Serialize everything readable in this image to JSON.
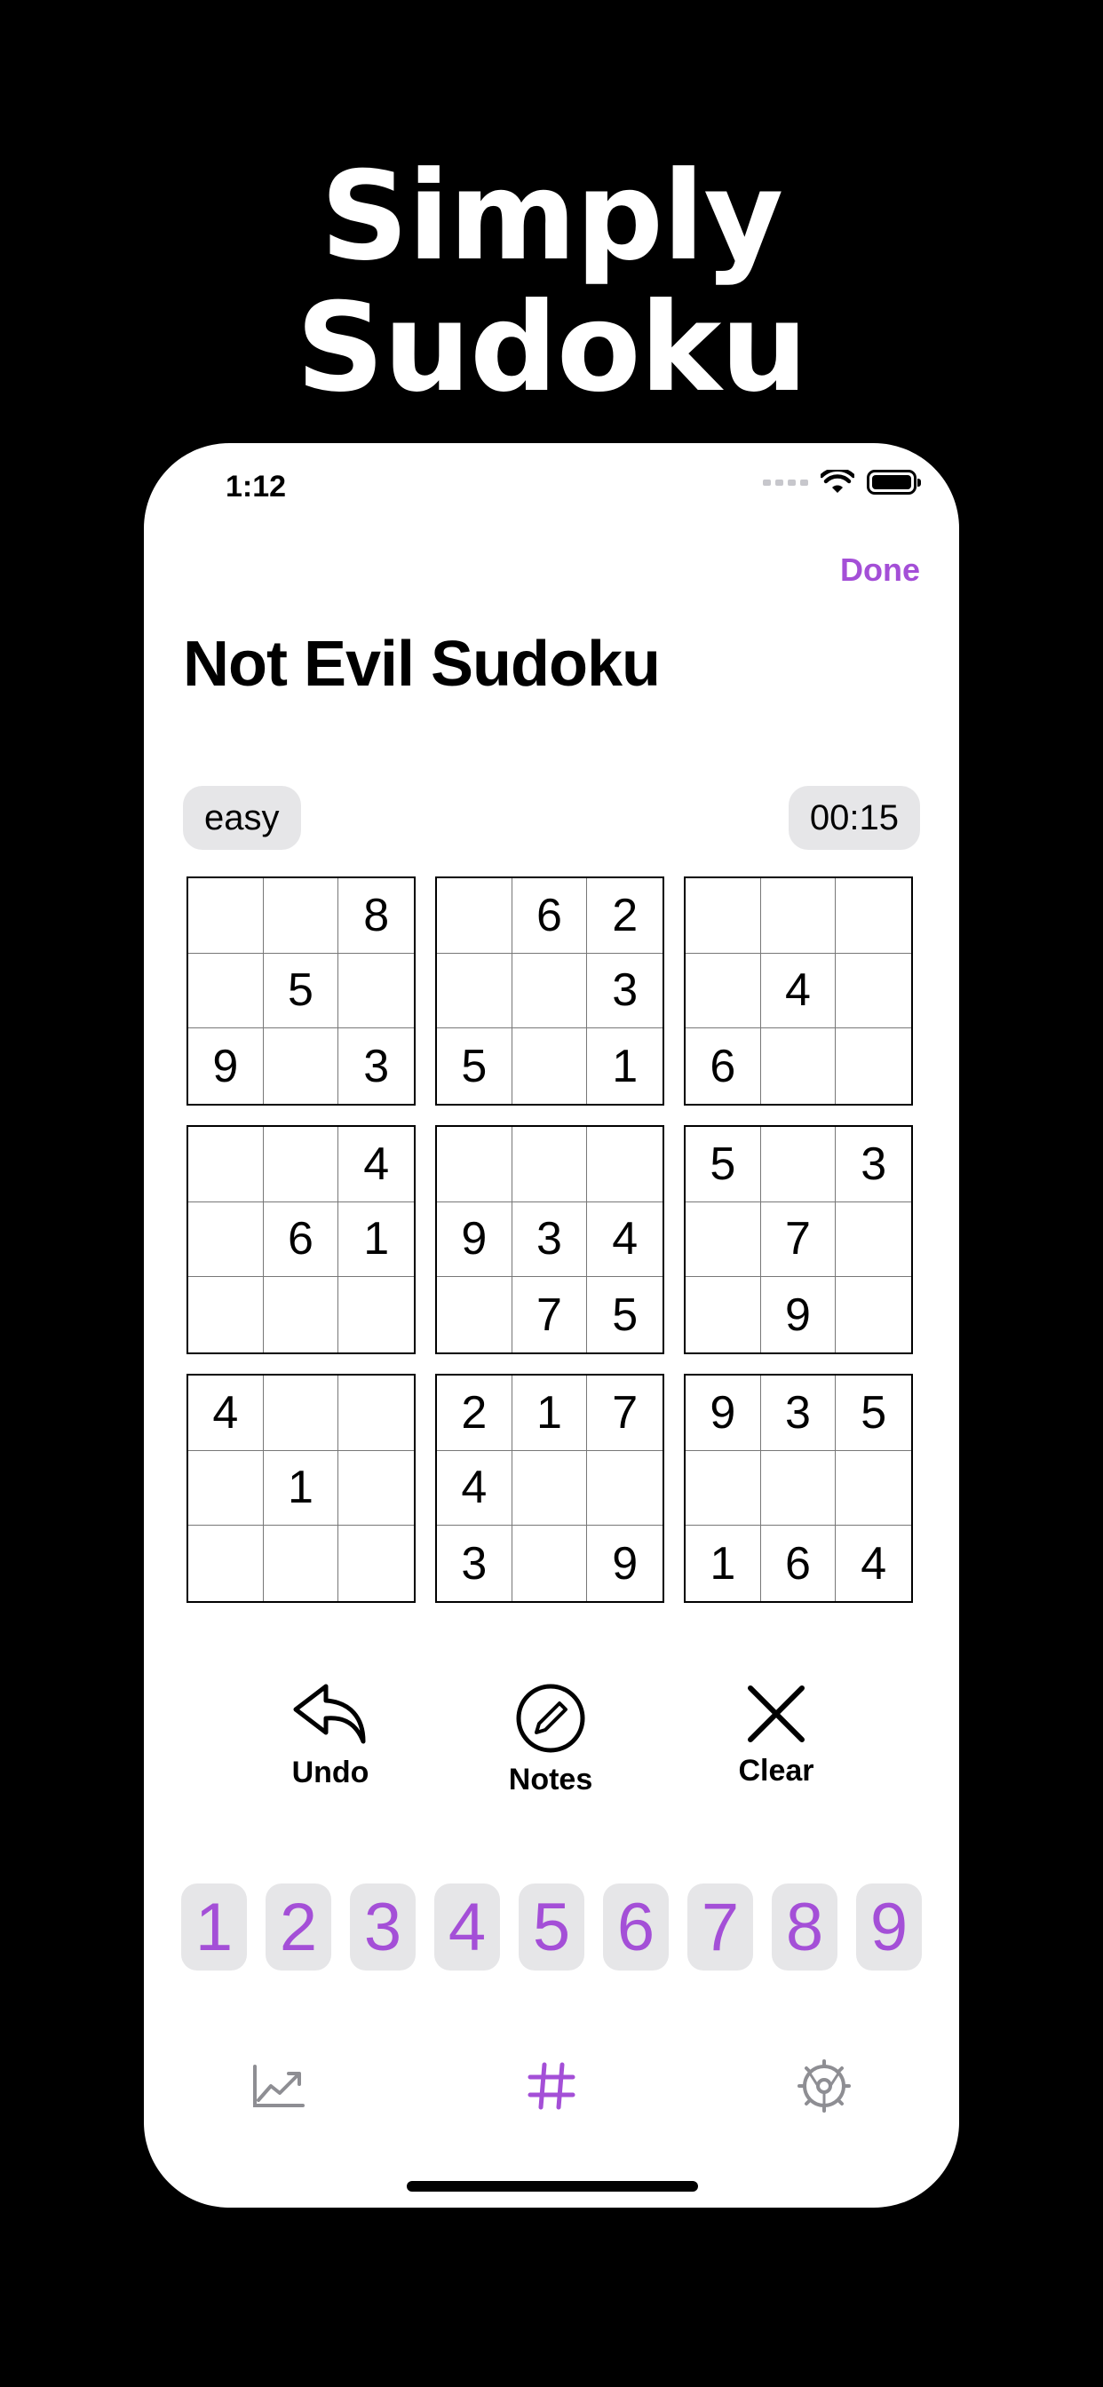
{
  "headline": {
    "line1": "Simply",
    "line2": "Sudoku"
  },
  "status_bar": {
    "time": "1:12"
  },
  "nav": {
    "done_label": "Done"
  },
  "screen": {
    "title": "Not Evil Sudoku",
    "difficulty": "easy",
    "timer": "00:15"
  },
  "puzzle": {
    "boxes": [
      [
        "",
        "",
        "8",
        "",
        "5",
        "",
        "9",
        "",
        "3"
      ],
      [
        "",
        "6",
        "2",
        "",
        "",
        "3",
        "5",
        "",
        "1"
      ],
      [
        "",
        "",
        "",
        "",
        "4",
        "",
        "6",
        "",
        ""
      ],
      [
        "",
        "",
        "4",
        "",
        "6",
        "1",
        "",
        "",
        ""
      ],
      [
        "",
        "",
        "",
        "9",
        "3",
        "4",
        "",
        "7",
        "5"
      ],
      [
        "5",
        "",
        "3",
        "",
        "7",
        "",
        "",
        "9",
        ""
      ],
      [
        "4",
        "",
        "",
        "",
        "1",
        "",
        "",
        "",
        ""
      ],
      [
        "2",
        "1",
        "7",
        "4",
        "",
        "",
        "3",
        "",
        "9"
      ],
      [
        "9",
        "3",
        "5",
        "",
        "",
        "",
        "1",
        "6",
        "4"
      ]
    ]
  },
  "tools": {
    "undo_label": "Undo",
    "notes_label": "Notes",
    "clear_label": "Clear"
  },
  "numpad": [
    "1",
    "2",
    "3",
    "4",
    "5",
    "6",
    "7",
    "8",
    "9"
  ],
  "tabbar": {
    "items": [
      "stats-icon",
      "sudoku-grid-icon",
      "settings-gear-icon"
    ]
  },
  "colors": {
    "accent": "#a44fd7",
    "pill_bg": "#e6e6e8",
    "icon_gray": "#8e8e93"
  }
}
